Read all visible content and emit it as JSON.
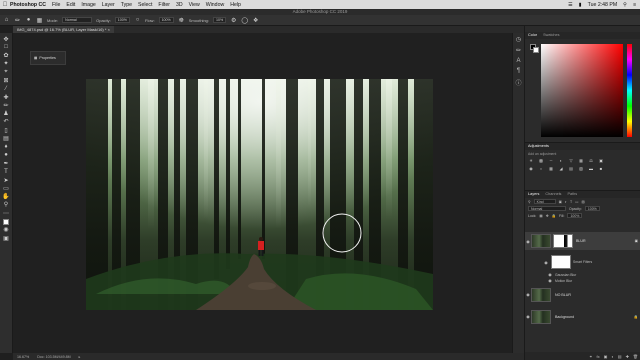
{
  "menubar": {
    "app": "Photoshop CC",
    "items": [
      "File",
      "Edit",
      "Image",
      "Layer",
      "Type",
      "Select",
      "Filter",
      "3D",
      "View",
      "Window",
      "Help"
    ],
    "clock": "Tue 2:48 PM"
  },
  "window_title": "Adobe Photoshop CC 2019",
  "options": {
    "mode_label": "Mode:",
    "mode_value": "Normal",
    "opacity_label": "Opacity:",
    "opacity_value": "100%",
    "flow_label": "Flow:",
    "flow_value": "100%",
    "smoothing_label": "Smoothing:",
    "smoothing_value": "10%"
  },
  "document_tab": "IMG_4874.psd @ 16.7% (BLUR, Layer Mask/16) *",
  "properties_label": "Properties",
  "status": {
    "zoom": "16.67%",
    "doc": "Doc: 103.5M/449.8M"
  },
  "panels": {
    "color_tabs": [
      "Color",
      "Swatches"
    ],
    "adjustments_title": "Adjustments",
    "adjustments_hint": "Add an adjustment",
    "layers_tabs": [
      "Layers",
      "Channels",
      "Paths"
    ],
    "kind_label": "Kind",
    "blend_mode": "Normal",
    "opacity_label": "Opacity:",
    "opacity_value": "100%",
    "lock_label": "Lock:",
    "fill_label": "Fill:",
    "fill_value": "100%"
  },
  "layers": [
    {
      "name": "BLUR"
    },
    {
      "name": "Smart Filters"
    },
    {
      "name": "Gaussian Blur"
    },
    {
      "name": "Motion Blur"
    },
    {
      "name": "NO BLUR"
    },
    {
      "name": "Background"
    }
  ],
  "colors": {
    "accent": "#ff0000",
    "panel": "#2b2b2b",
    "jacket": "#d42020"
  }
}
